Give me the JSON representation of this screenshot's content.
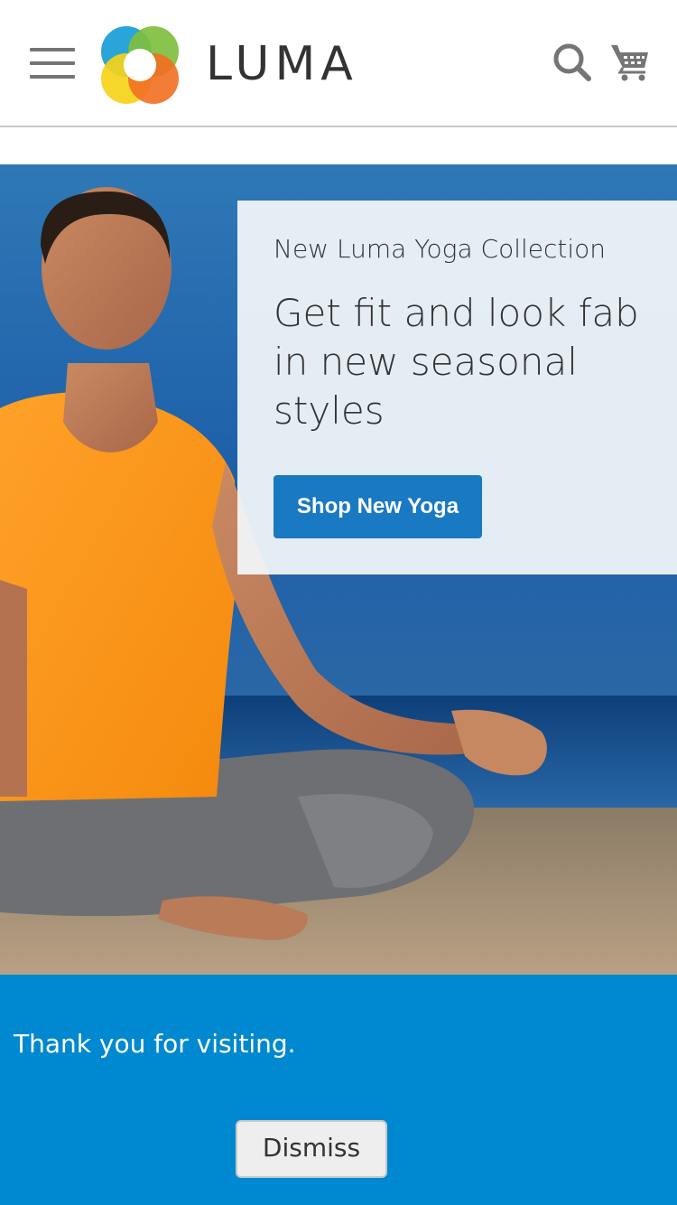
{
  "header": {
    "menu_icon": "hamburger-menu-icon",
    "logo_text": "LUMA",
    "search_icon": "search-icon",
    "cart_icon": "shopping-cart-icon"
  },
  "hero": {
    "kicker": "New Luma Yoga Collection",
    "headline": "Get fit and look fab in new seasonal styles",
    "cta_label": "Shop New Yoga"
  },
  "notice": {
    "message": "Thank you for visiting.",
    "dismiss_label": "Dismiss"
  },
  "colors": {
    "accent": "#1979c3",
    "notice_bg": "#0088d0",
    "logo_blue": "#1fa0d8",
    "logo_green": "#7fbf3f",
    "logo_yellow": "#f6d219",
    "logo_orange": "#f26f21"
  }
}
